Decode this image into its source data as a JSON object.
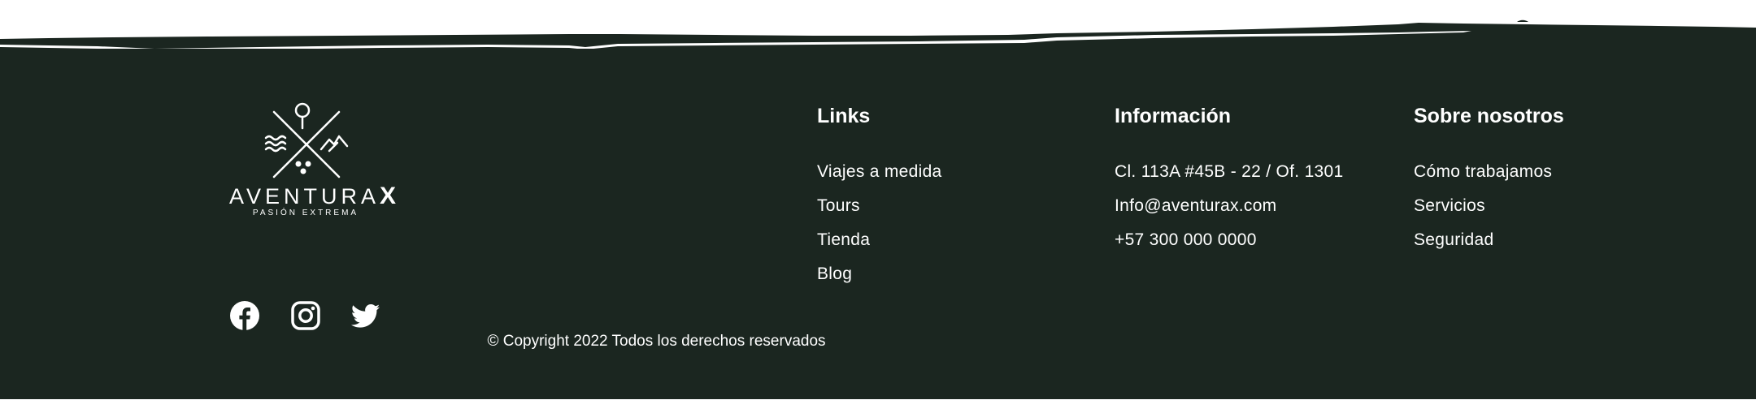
{
  "brand": {
    "name_main": "AVENTURA",
    "name_accent": "X",
    "tagline": "PASIÓN EXTREMA"
  },
  "social": {
    "icons": [
      "facebook-icon",
      "instagram-icon",
      "twitter-icon"
    ]
  },
  "columns": {
    "links": {
      "title": "Links",
      "items": [
        "Viajes a medida",
        "Tours",
        "Tienda",
        "Blog"
      ]
    },
    "info": {
      "title": "Información",
      "items": [
        "Cl. 113A #45B - 22 / Of. 1301",
        "Info@aventurax.com",
        "+57 300 000 0000"
      ]
    },
    "about": {
      "title": "Sobre nosotros",
      "items": [
        "Cómo trabajamos",
        "Servicios",
        "Seguridad"
      ]
    }
  },
  "copyright": "© Copyright 2022 Todos los derechos reservados",
  "colors": {
    "footer_bg": "#1b2620",
    "text": "#ffffff",
    "page_bg": "#ffffff"
  }
}
